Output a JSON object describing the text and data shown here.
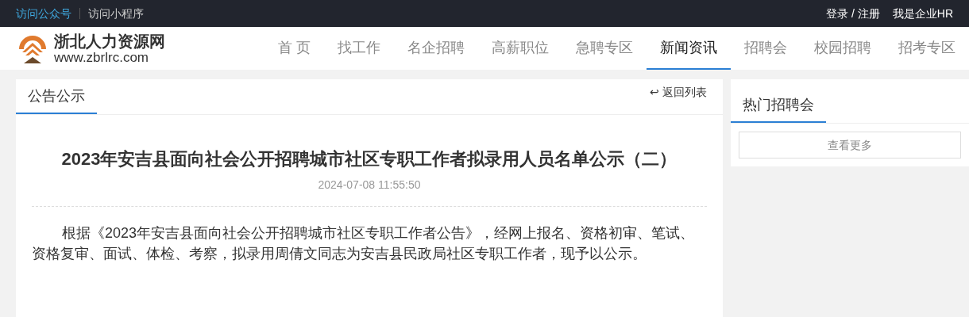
{
  "top_bar": {
    "links": [
      {
        "label": "访问公众号",
        "selected": true
      },
      {
        "label": "访问小程序",
        "selected": false
      }
    ],
    "login": "登录 / 注册",
    "hr": "我是企业HR"
  },
  "header": {
    "logo_name": "浙北人力资源网",
    "logo_url": "www.zbrlrc.com",
    "nav": [
      {
        "label": "首 页",
        "selected": false
      },
      {
        "label": "找工作",
        "selected": false
      },
      {
        "label": "名企招聘",
        "selected": false
      },
      {
        "label": "高薪职位",
        "selected": false
      },
      {
        "label": "急聘专区",
        "selected": false
      },
      {
        "label": "新闻资讯",
        "selected": true
      },
      {
        "label": "招聘会",
        "selected": false
      },
      {
        "label": "校园招聘",
        "selected": false
      },
      {
        "label": "招考专区",
        "selected": false
      }
    ]
  },
  "article": {
    "tab": "公告公示",
    "back": "↩ 返回列表",
    "title": "2023年安吉县面向社会公开招聘城市社区专职工作者拟录用人员名单公示（二）",
    "date": "2024-07-08 11:55:50",
    "body": "根据《2023年安吉县面向社会公开招聘城市社区专职工作者公告》，经网上报名、资格初审、笔试、资格复审、面试、体检、考察，拟录用周倩文同志为安吉县民政局社区专职工作者，现予以公示。"
  },
  "sidebar": {
    "title": "热门招聘会",
    "more": "查看更多"
  }
}
